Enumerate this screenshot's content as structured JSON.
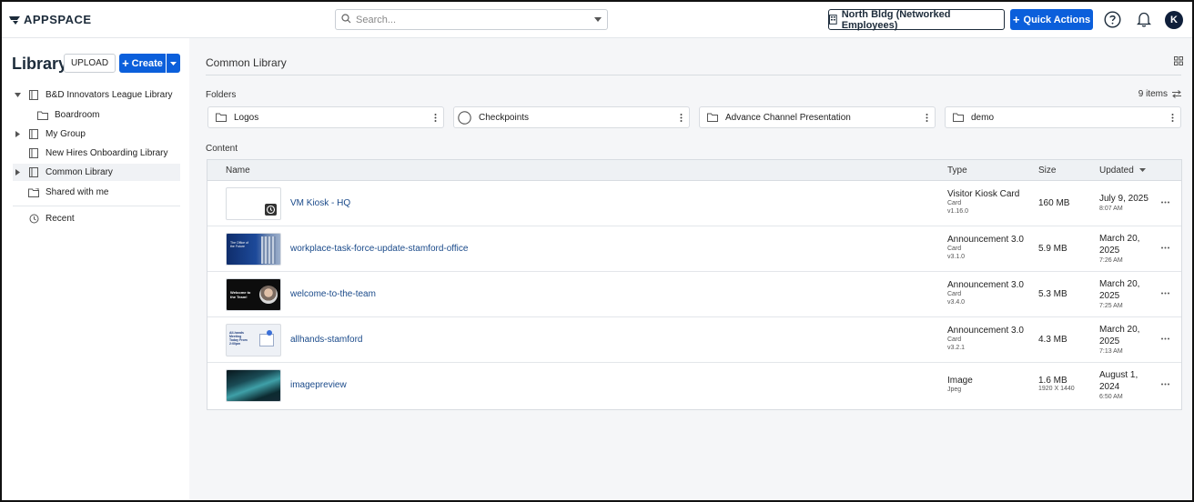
{
  "header": {
    "logo_text": "APPSPACE",
    "search_placeholder": "Search...",
    "location_label": "North Bldg (Networked Employees)",
    "quick_actions_label": "Quick Actions",
    "avatar_initial": "K"
  },
  "sidebar": {
    "title": "Library",
    "upload_label": "UPLOAD",
    "create_label": "Create",
    "items": [
      {
        "label": "B&D Innovators League Library"
      },
      {
        "label": "Boardroom"
      },
      {
        "label": "My Group"
      },
      {
        "label": "New Hires Onboarding Library"
      },
      {
        "label": "Common Library"
      },
      {
        "label": "Shared with me"
      },
      {
        "label": "Recent"
      }
    ]
  },
  "main": {
    "breadcrumb": "Common Library",
    "folders_label": "Folders",
    "item_count": "9 items",
    "folders": [
      {
        "name": "Logos"
      },
      {
        "name": "Checkpoints"
      },
      {
        "name": "Advance Channel Presentation"
      },
      {
        "name": "demo"
      }
    ],
    "content_label": "Content",
    "columns": {
      "name": "Name",
      "type": "Type",
      "size": "Size",
      "updated": "Updated"
    },
    "rows": [
      {
        "name": "VM Kiosk - HQ",
        "type": "Visitor Kiosk Card",
        "type_sub1": "Card",
        "type_sub2": "v1.16.0",
        "size": "160 MB",
        "size_sub": "",
        "updated": "July 9, 2025",
        "time": "8:07 AM"
      },
      {
        "name": "workplace-task-force-update-stamford-office",
        "type": "Announcement 3.0",
        "type_sub1": "Card",
        "type_sub2": "v3.1.0",
        "size": "5.9 MB",
        "size_sub": "",
        "updated_l1": "March 20,",
        "updated_l2": "2025",
        "time": "7:26 AM"
      },
      {
        "name": "welcome-to-the-team",
        "type": "Announcement 3.0",
        "type_sub1": "Card",
        "type_sub2": "v3.4.0",
        "size": "5.3 MB",
        "size_sub": "",
        "updated_l1": "March 20,",
        "updated_l2": "2025",
        "time": "7:25 AM"
      },
      {
        "name": "allhands-stamford",
        "type": "Announcement 3.0",
        "type_sub1": "Card",
        "type_sub2": "v3.2.1",
        "size": "4.3 MB",
        "size_sub": "",
        "updated_l1": "March 20,",
        "updated_l2": "2025",
        "time": "7:13 AM"
      },
      {
        "name": "imagepreview",
        "type": "Image",
        "type_sub1": "Jpeg",
        "type_sub2": "",
        "size": "1.6 MB",
        "size_sub": "1920 X 1440",
        "updated_l1": "August 1,",
        "updated_l2": "2024",
        "time": "6:50 AM"
      }
    ],
    "thumb_texts": {
      "row1_title": "The Office of the Future",
      "row2_title": "Welcome to the Team!",
      "row3_title": "All-hands Meeting Today From 2:00pm"
    }
  },
  "colors": {
    "accent": "#0b5fdb",
    "navy": "#1c2b3a",
    "link": "#1a4a8a"
  }
}
